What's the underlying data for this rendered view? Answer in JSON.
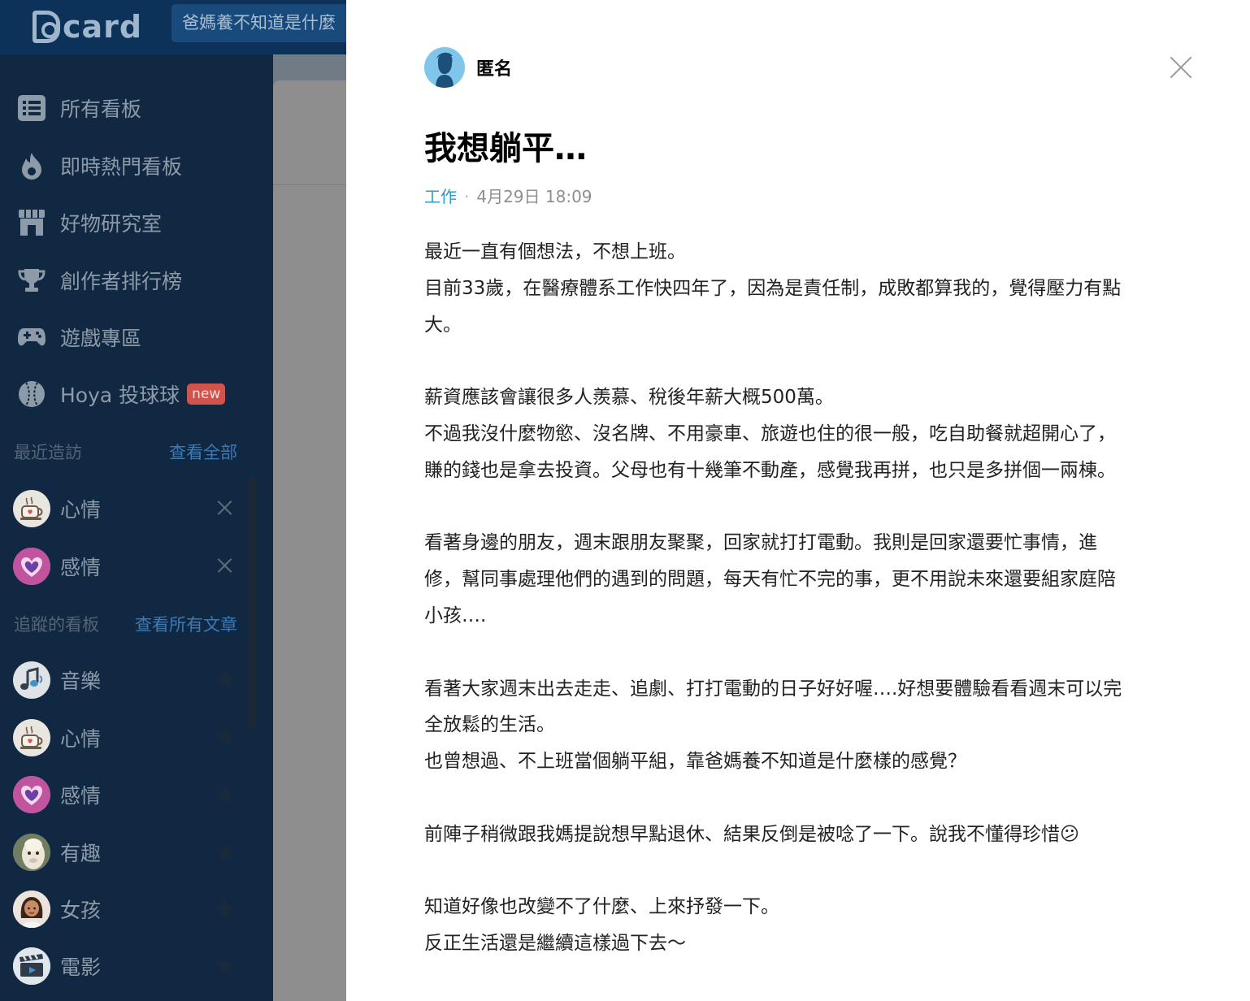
{
  "header": {
    "logo_text": "card",
    "search_value": "爸媽養不知道是什麼"
  },
  "sidebar": {
    "nav": [
      {
        "label": "所有看板",
        "icon": "list-icon"
      },
      {
        "label": "即時熱門看板",
        "icon": "fire-icon"
      },
      {
        "label": "好物研究室",
        "icon": "store-icon"
      },
      {
        "label": "創作者排行榜",
        "icon": "trophy-icon"
      },
      {
        "label": "遊戲專區",
        "icon": "gamepad-icon"
      },
      {
        "label": "Hoya 投球球",
        "icon": "baseball-icon",
        "badge": "new"
      }
    ],
    "recent": {
      "title": "最近造訪",
      "link": "查看全部",
      "items": [
        {
          "label": "心情",
          "icon": "coffee-cup-icon"
        },
        {
          "label": "感情",
          "icon": "heart-icon"
        }
      ]
    },
    "following": {
      "title": "追蹤的看板",
      "link": "查看所有文章",
      "items": [
        {
          "label": "音樂",
          "icon": "music-note-icon"
        },
        {
          "label": "心情",
          "icon": "coffee-cup-icon"
        },
        {
          "label": "感情",
          "icon": "heart-icon"
        },
        {
          "label": "有趣",
          "icon": "alpaca-icon"
        },
        {
          "label": "女孩",
          "icon": "girl-icon"
        },
        {
          "label": "電影",
          "icon": "clapperboard-icon"
        }
      ]
    }
  },
  "post": {
    "author": "匿名",
    "title": "我想躺平…",
    "forum": "工作",
    "separator": "·",
    "time": "4月29日 18:09",
    "lines": [
      "最近一直有個想法，不想上班。",
      "目前33歲，在醫療體系工作快四年了，因為是責任制，成敗都算我的，覺得壓力有點",
      "大。",
      "",
      "薪資應該會讓很多人羨慕、稅後年薪大概500萬。",
      "不過我沒什麼物慾、沒名牌、不用豪車、旅遊也住的很一般，吃自助餐就超開心了，",
      "賺的錢也是拿去投資。父母也有十幾筆不動產，感覺我再拼，也只是多拼個一兩棟。",
      "",
      "看著身邊的朋友，週末跟朋友聚聚，回家就打打電動。我則是回家還要忙事情，進",
      "修，幫同事處理他們的遇到的問題，每天有忙不完的事，更不用說未來還要組家庭陪",
      "小孩….",
      "",
      "看著大家週末出去走走、追劇、打打電動的日子好好喔….好想要體驗看看週末可以完",
      "全放鬆的生活。",
      "也曾想過、不上班當個躺平組，靠爸媽養不知道是什麼樣的感覺？",
      "",
      "前陣子稍微跟我媽提說想早點退休、結果反倒是被唸了一下。說我不懂得珍惜😕",
      "",
      "知道好像也改變不了什麼、上來抒發一下。",
      "反正生活還是繼續這樣過下去～"
    ]
  },
  "colors": {
    "header_bg": "#0c3259",
    "sidebar_bg": "#102842",
    "link_blue": "#3a7ab7",
    "forum_blue": "#3397cf",
    "badge_red": "#d1534b"
  }
}
